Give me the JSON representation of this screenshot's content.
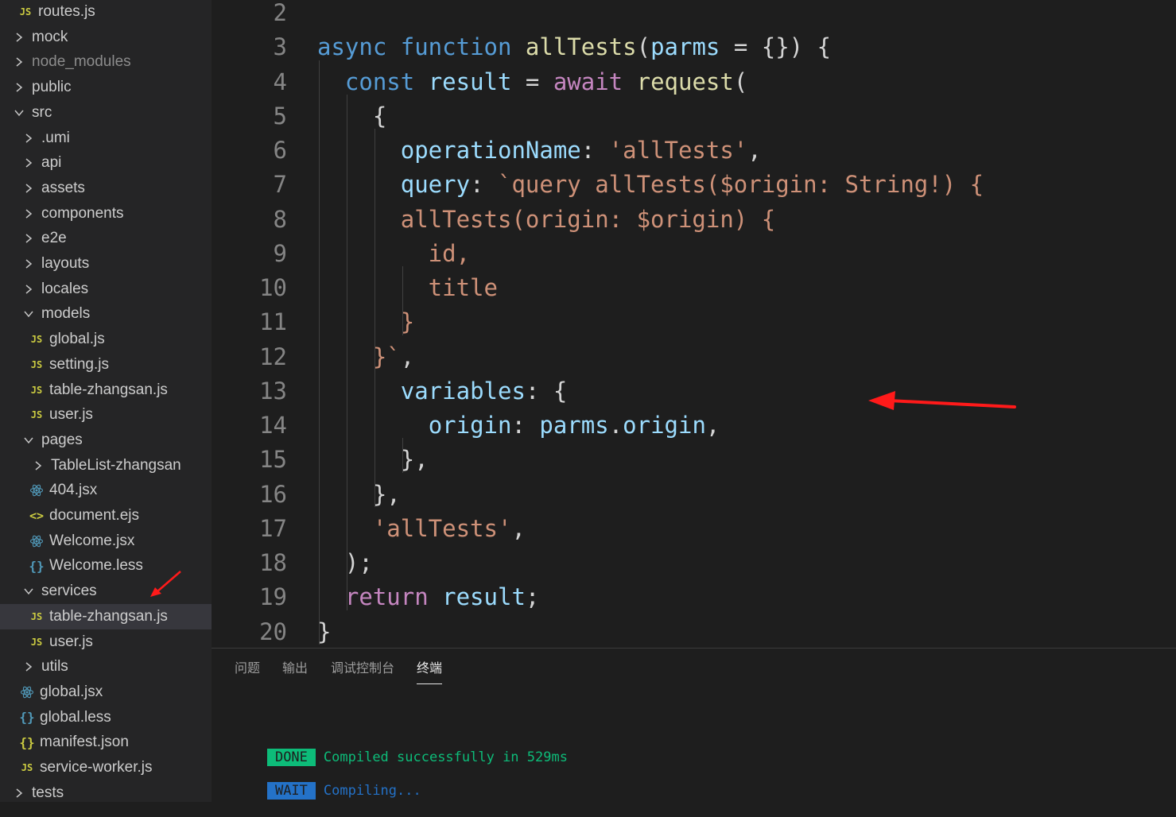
{
  "explorer": {
    "items": [
      {
        "label": "routes.js",
        "type": "js"
      },
      {
        "label": "mock",
        "type": "folder-closed"
      },
      {
        "label": "node_modules",
        "type": "folder-closed"
      },
      {
        "label": "public",
        "type": "folder-closed"
      },
      {
        "label": "src",
        "type": "folder-open"
      },
      {
        "label": ".umi",
        "type": "folder-closed"
      },
      {
        "label": "api",
        "type": "folder-closed"
      },
      {
        "label": "assets",
        "type": "folder-closed"
      },
      {
        "label": "components",
        "type": "folder-closed"
      },
      {
        "label": "e2e",
        "type": "folder-closed"
      },
      {
        "label": "layouts",
        "type": "folder-closed"
      },
      {
        "label": "locales",
        "type": "folder-closed"
      },
      {
        "label": "models",
        "type": "folder-open"
      },
      {
        "label": "global.js",
        "type": "js"
      },
      {
        "label": "setting.js",
        "type": "js"
      },
      {
        "label": "table-zhangsan.js",
        "type": "js"
      },
      {
        "label": "user.js",
        "type": "js"
      },
      {
        "label": "pages",
        "type": "folder-open"
      },
      {
        "label": "TableList-zhangsan",
        "type": "folder-closed"
      },
      {
        "label": "404.jsx",
        "type": "react"
      },
      {
        "label": "document.ejs",
        "type": "ejs"
      },
      {
        "label": "Welcome.jsx",
        "type": "react"
      },
      {
        "label": "Welcome.less",
        "type": "less"
      },
      {
        "label": "services",
        "type": "folder-open"
      },
      {
        "label": "table-zhangsan.js",
        "type": "js",
        "selected": true
      },
      {
        "label": "user.js",
        "type": "js"
      },
      {
        "label": "utils",
        "type": "folder-closed"
      },
      {
        "label": "global.jsx",
        "type": "react"
      },
      {
        "label": "global.less",
        "type": "less"
      },
      {
        "label": "manifest.json",
        "type": "json"
      },
      {
        "label": "service-worker.js",
        "type": "js"
      },
      {
        "label": "tests",
        "type": "folder-closed"
      }
    ]
  },
  "editor": {
    "lines": [
      {
        "n": "2",
        "tokens": []
      },
      {
        "n": "3",
        "tokens": [
          [
            "kw",
            "async "
          ],
          [
            "kw",
            "function "
          ],
          [
            "fn",
            "allTests"
          ],
          [
            "pun",
            "("
          ],
          [
            "var",
            "parms"
          ],
          [
            "pun",
            " = {}) {"
          ]
        ]
      },
      {
        "n": "4",
        "tokens": [
          [
            "pun",
            "  "
          ],
          [
            "kw",
            "const "
          ],
          [
            "var",
            "result"
          ],
          [
            "pun",
            " = "
          ],
          [
            "ctl",
            "await "
          ],
          [
            "fn",
            "request"
          ],
          [
            "pun",
            "("
          ]
        ]
      },
      {
        "n": "5",
        "tokens": [
          [
            "pun",
            "    {"
          ]
        ]
      },
      {
        "n": "6",
        "tokens": [
          [
            "pun",
            "      "
          ],
          [
            "var",
            "operationName"
          ],
          [
            "pun",
            ": "
          ],
          [
            "str",
            "'allTests'"
          ],
          [
            "pun",
            ","
          ]
        ]
      },
      {
        "n": "7",
        "tokens": [
          [
            "pun",
            "      "
          ],
          [
            "var",
            "query"
          ],
          [
            "pun",
            ": "
          ],
          [
            "str",
            "`query allTests($origin: String!) {"
          ]
        ]
      },
      {
        "n": "8",
        "tokens": [
          [
            "str",
            "      allTests(origin: $origin) {"
          ]
        ]
      },
      {
        "n": "9",
        "tokens": [
          [
            "str",
            "        id,"
          ]
        ]
      },
      {
        "n": "10",
        "tokens": [
          [
            "str",
            "        title"
          ]
        ]
      },
      {
        "n": "11",
        "tokens": [
          [
            "str",
            "      }"
          ]
        ]
      },
      {
        "n": "12",
        "tokens": [
          [
            "str",
            "    }`"
          ],
          [
            "pun",
            ","
          ]
        ]
      },
      {
        "n": "13",
        "tokens": [
          [
            "pun",
            "      "
          ],
          [
            "var",
            "variables"
          ],
          [
            "pun",
            ": {"
          ]
        ]
      },
      {
        "n": "14",
        "tokens": [
          [
            "pun",
            "        "
          ],
          [
            "var",
            "origin"
          ],
          [
            "pun",
            ": "
          ],
          [
            "var",
            "parms"
          ],
          [
            "pun",
            "."
          ],
          [
            "var",
            "origin"
          ],
          [
            "pun",
            ","
          ]
        ]
      },
      {
        "n": "15",
        "tokens": [
          [
            "pun",
            "      },"
          ]
        ]
      },
      {
        "n": "16",
        "tokens": [
          [
            "pun",
            "    },"
          ]
        ]
      },
      {
        "n": "17",
        "tokens": [
          [
            "pun",
            "    "
          ],
          [
            "str",
            "'allTests'"
          ],
          [
            "pun",
            ","
          ]
        ]
      },
      {
        "n": "18",
        "tokens": [
          [
            "pun",
            "  );"
          ]
        ]
      },
      {
        "n": "19",
        "tokens": [
          [
            "pun",
            "  "
          ],
          [
            "ctl",
            "return "
          ],
          [
            "var",
            "result"
          ],
          [
            "pun",
            ";"
          ]
        ]
      },
      {
        "n": "20",
        "tokens": [
          [
            "pun",
            "}"
          ]
        ]
      }
    ]
  },
  "panel": {
    "tabs": [
      "问题",
      "输出",
      "调试控制台",
      "终端"
    ],
    "active_tab": "终端",
    "terminal": {
      "done_badge": "DONE",
      "done_message": "Compiled successfully in 529ms",
      "wait_badge": "WAIT",
      "wait_message": "Compiling..."
    }
  },
  "colors": {
    "annotation_arrow": "#ff1a1a"
  }
}
